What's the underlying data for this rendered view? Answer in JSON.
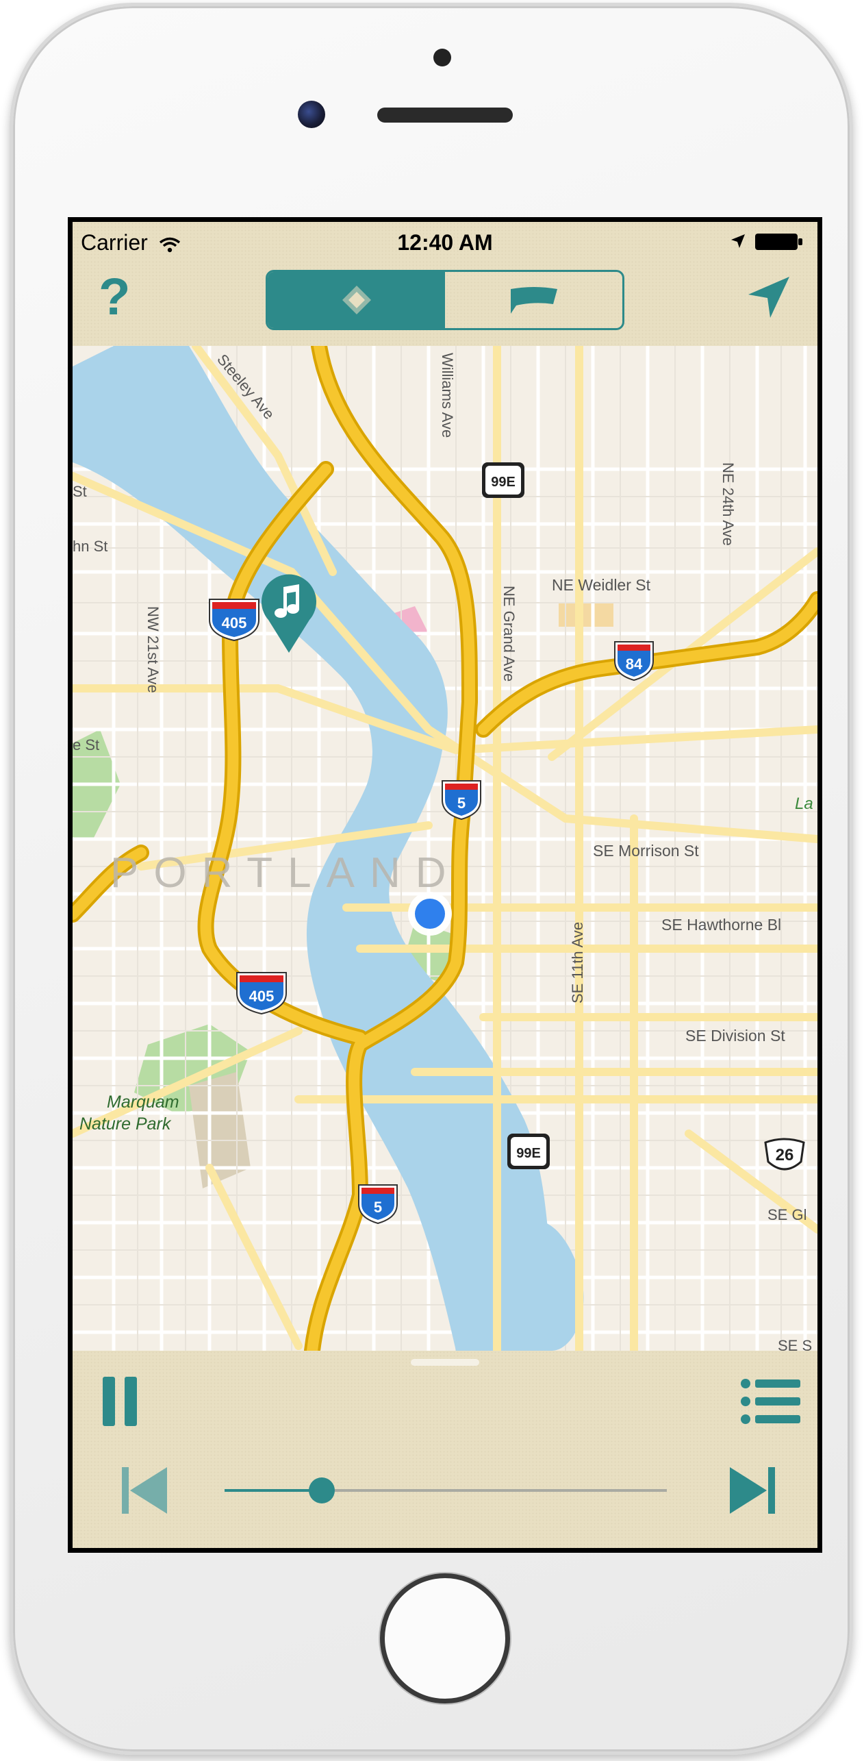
{
  "status_bar": {
    "carrier": "Carrier",
    "time": "12:40 AM",
    "icons": [
      "wifi-icon",
      "location-arrow-icon",
      "battery-icon"
    ]
  },
  "nav_bar": {
    "help_label": "?",
    "segments": [
      {
        "icon": "diamond-icon",
        "selected": true
      },
      {
        "icon": "flag-icon",
        "selected": false
      }
    ],
    "locate_icon": "navigation-arrow-icon"
  },
  "map": {
    "city_label": "PORTLAND",
    "street_labels": {
      "steeley": "Steeley Ave",
      "williams": "Williams Ave",
      "ne24": "NE 24th Ave",
      "nth_st": "hn St",
      "st_left": "St",
      "ne_weidler": "NE Weidler St",
      "nw21": "NW 21st Ave",
      "ne_grand": "NE Grand Ave",
      "e_st": "e St",
      "la": "La",
      "se_morrison": "SE Morrison St",
      "se11": "SE 11th Ave",
      "se_hawthorne": "SE Hawthorne Bl",
      "se_division": "SE Division St",
      "se_gl": "SE Gl",
      "se_s": "SE S",
      "park_line1": "Marquam",
      "park_line2": "Nature Park"
    },
    "shields": {
      "i405_a": "405",
      "i405_b": "405",
      "i5_a": "5",
      "i5_b": "5",
      "i84": "84",
      "r99e_a": "99E",
      "r99e_b": "99E",
      "us26": "26"
    },
    "pin_icon": "music-note-icon",
    "current_location_icon": "blue-dot-icon"
  },
  "player": {
    "pause_icon": "pause-icon",
    "list_icon": "list-icon",
    "prev_icon": "skip-back-icon",
    "next_icon": "skip-forward-icon",
    "progress": 0.22
  },
  "colors": {
    "accent": "#2d8a8a",
    "paper": "#e8dfc2",
    "water": "#aad3ea",
    "highway": "#f6c62e",
    "location_dot": "#2f80ed"
  }
}
